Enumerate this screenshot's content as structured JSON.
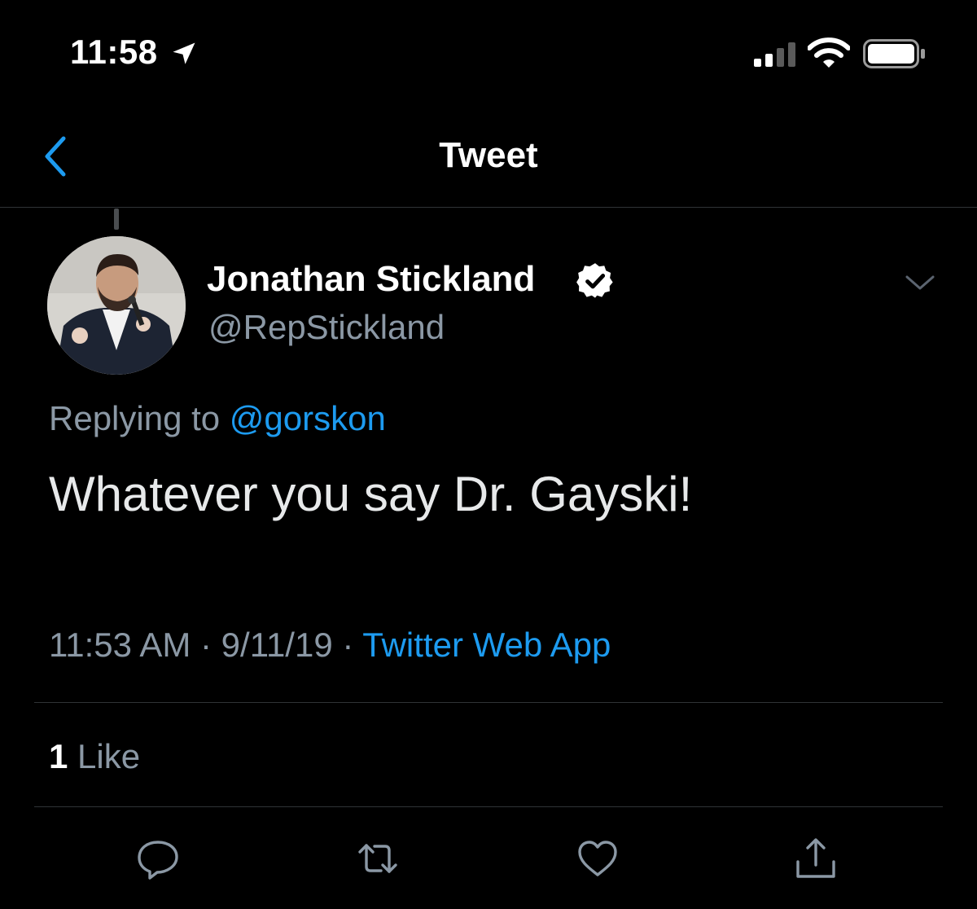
{
  "status_bar": {
    "time": "11:58",
    "location_icon": "location-arrow-icon",
    "signal_icon": "cellular-signal-icon",
    "wifi_icon": "wifi-icon",
    "battery_icon": "battery-icon"
  },
  "nav": {
    "title": "Tweet",
    "back_icon": "chevron-left-icon"
  },
  "tweet": {
    "author_name": "Jonathan Stickland",
    "handle": "@RepStickland",
    "verified": true,
    "replying_prefix": "Replying to",
    "replying_to": "@gorskon",
    "text": "Whatever you say Dr. Gayski!",
    "time": "11:53 AM",
    "separator": " · ",
    "date": "9/11/19",
    "source": "Twitter Web App",
    "like_count": "1",
    "like_label": "Like"
  },
  "actions": [
    {
      "name": "reply",
      "icon": "speech-bubble-icon"
    },
    {
      "name": "retweet",
      "icon": "retweet-icon"
    },
    {
      "name": "like",
      "icon": "heart-icon"
    },
    {
      "name": "share",
      "icon": "share-icon"
    }
  ],
  "colors": {
    "background": "#000000",
    "accent": "#1d9bf0",
    "secondary_text": "#8b98a5",
    "divider": "#2f3336"
  }
}
